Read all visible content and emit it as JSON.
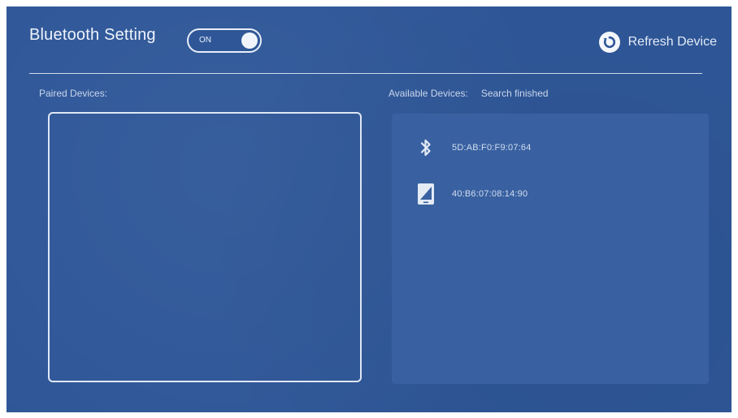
{
  "header": {
    "title": "Bluetooth Setting",
    "toggle_label": "ON",
    "refresh_label": "Refresh Device"
  },
  "paired": {
    "label": "Paired Devices:"
  },
  "available": {
    "label": "Available Devices:",
    "status": "Search finished",
    "devices": [
      {
        "icon": "bluetooth-icon",
        "address": "5D:AB:F0:F9:07:64"
      },
      {
        "icon": "phone-icon",
        "address": "40:B6:07:08:14:90"
      }
    ]
  },
  "colors": {
    "background": "#2f5798",
    "panel": "#3a62a2",
    "foreground": "#e7eef9"
  }
}
